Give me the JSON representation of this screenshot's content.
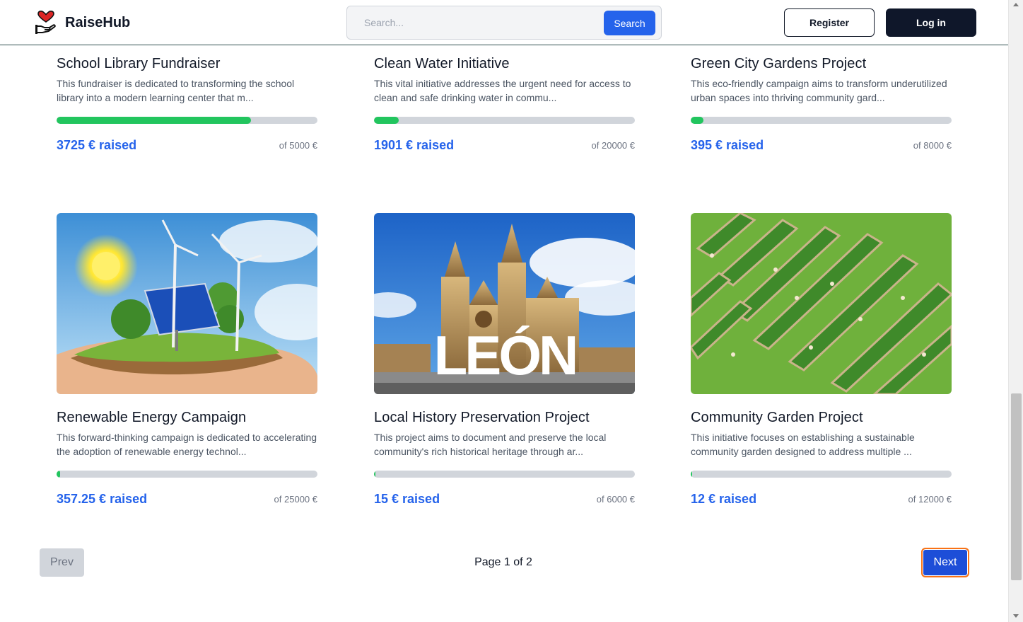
{
  "header": {
    "brand": "RaiseHub",
    "search_placeholder": "Search...",
    "search_button": "Search",
    "register_button": "Register",
    "login_button": "Log in"
  },
  "campaigns": [
    {
      "title": "School Library Fundraiser",
      "description": "This fundraiser is dedicated to transforming the school library into a modern learning center that m...",
      "raised_label": "3725 € raised",
      "goal_label": "of 5000 €",
      "progress": 0.745,
      "image": "none"
    },
    {
      "title": "Clean Water Initiative",
      "description": "This vital initiative addresses the urgent need for access to clean and safe drinking water in commu...",
      "raised_label": "1901 € raised",
      "goal_label": "of 20000 €",
      "progress": 0.095,
      "image": "none"
    },
    {
      "title": "Green City Gardens Project",
      "description": "This eco-friendly campaign aims to transform underutilized urban spaces into thriving community gard...",
      "raised_label": "395 € raised",
      "goal_label": "of 8000 €",
      "progress": 0.049,
      "image": "none"
    },
    {
      "title": "Renewable Energy Campaign",
      "description": "This forward-thinking campaign is dedicated to accelerating the adoption of renewable energy technol...",
      "raised_label": "357.25 € raised",
      "goal_label": "of 25000 €",
      "progress": 0.014,
      "image": "renewable-energy"
    },
    {
      "title": "Local History Preservation Project",
      "description": "This project aims to document and preserve the local community's rich historical heritage through ar...",
      "raised_label": "15 € raised",
      "goal_label": "of 6000 €",
      "progress": 0.0025,
      "image": "cathedral",
      "image_text": "LEÓN"
    },
    {
      "title": "Community Garden Project",
      "description": "This initiative focuses on establishing a sustainable community garden designed to address multiple ...",
      "raised_label": "12 € raised",
      "goal_label": "of 12000 €",
      "progress": 0.001,
      "image": "garden"
    }
  ],
  "pagination": {
    "prev": "Prev",
    "page_info": "Page 1 of 2",
    "next": "Next"
  },
  "colors": {
    "accent": "#2563eb",
    "progress": "#22c55e",
    "track": "#d1d5db",
    "dark": "#0f172a"
  }
}
